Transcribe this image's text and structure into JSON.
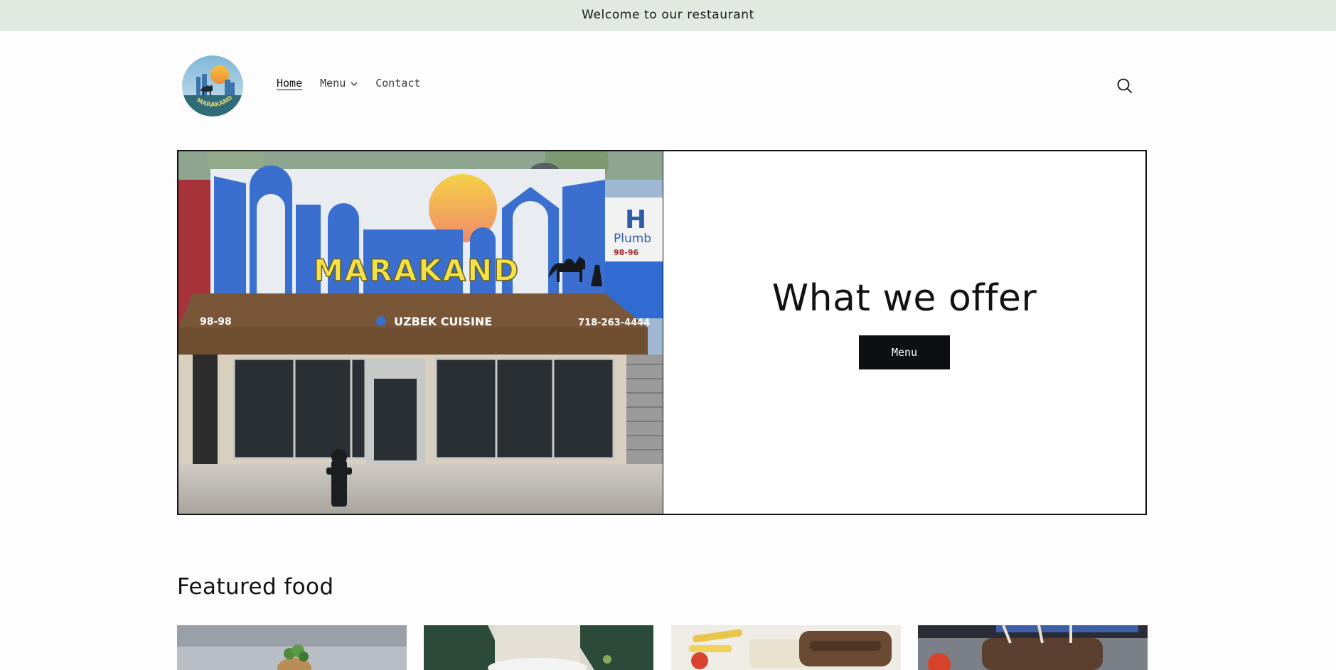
{
  "announcement": {
    "text": "Welcome to our restaurant"
  },
  "header": {
    "logo": {
      "text": "MARAKAND"
    },
    "nav": [
      {
        "label": "Home",
        "active": true
      },
      {
        "label": "Menu",
        "has_dropdown": true
      },
      {
        "label": "Contact"
      }
    ],
    "search_icon": "search-icon"
  },
  "hero": {
    "image": {
      "sign_text": "MARAKAND",
      "awning_text": "UZBEK CUISINE",
      "address": "98-98",
      "phone": "718-263-4444",
      "neighbor_sign": "Plumb",
      "neighbor_address": "98-96"
    },
    "title": "What we offer",
    "button_label": "Menu"
  },
  "featured": {
    "title": "Featured food",
    "cards": [
      {
        "image": "dish-1"
      },
      {
        "image": "dish-2"
      },
      {
        "image": "dish-3"
      },
      {
        "image": "dish-4"
      }
    ]
  },
  "colors": {
    "announcement_bg": "#e1e9e1",
    "button_bg": "#0d0f12",
    "text": "#121212",
    "sign_blue": "#3a6fd0",
    "sign_yellow": "#f3e14a",
    "awning_brown": "#7a5638"
  }
}
